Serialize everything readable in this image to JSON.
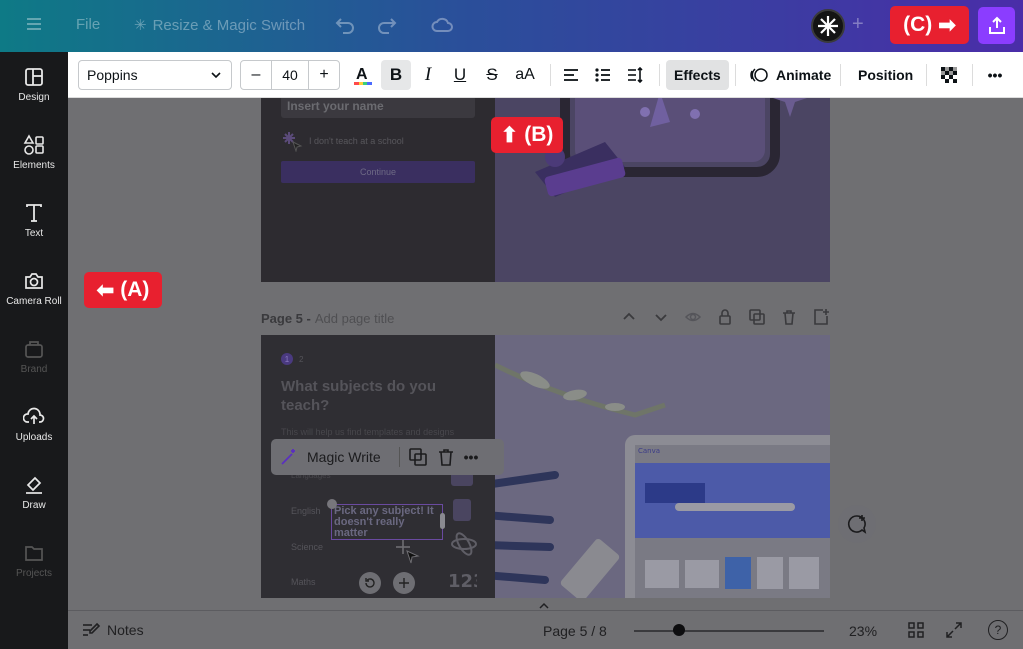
{
  "topbar": {
    "file_label": "File",
    "resize_label": "Resize & Magic Switch",
    "plus_label": "+"
  },
  "sidebar": {
    "items": [
      {
        "label": "Design",
        "icon": "layout-icon",
        "enabled": true
      },
      {
        "label": "Elements",
        "icon": "shapes-icon",
        "enabled": true
      },
      {
        "label": "Text",
        "icon": "text-icon",
        "enabled": true
      },
      {
        "label": "Camera Roll",
        "icon": "camera-icon",
        "enabled": true
      },
      {
        "label": "Brand",
        "icon": "brand-icon",
        "enabled": false
      },
      {
        "label": "Uploads",
        "icon": "upload-cloud-icon",
        "enabled": true
      },
      {
        "label": "Draw",
        "icon": "pen-icon",
        "enabled": true
      },
      {
        "label": "Projects",
        "icon": "folder-icon",
        "enabled": false
      }
    ]
  },
  "text_toolbar": {
    "font": "Poppins",
    "size_minus": "–",
    "font_size": "40",
    "size_plus": "+",
    "bold": "B",
    "italic": "I",
    "underline": "U",
    "strike": "S",
    "case": "aA",
    "effects_label": "Effects",
    "animate_label": "Animate",
    "position_label": "Position",
    "more": "•••"
  },
  "page4": {
    "input_placeholder": "Insert your name",
    "checkbox_label": "I don't teach at a school",
    "continue_label": "Continue"
  },
  "page5": {
    "title": "Page 5 -",
    "title_placeholder": "Add page title",
    "step_1": "1",
    "step_2": "2",
    "heading": "What subjects do you teach?",
    "subtext": "This will help us find templates and designs",
    "option_languages": "Languages",
    "option_english": "English",
    "option_science": "Science",
    "option_maths": "Maths",
    "selected_text": "Pick any subject! It doesn't really matter",
    "laptop_brand": "Canva"
  },
  "magic_bar": {
    "label": "Magic Write",
    "more": "•••"
  },
  "callouts": {
    "a": "(A)",
    "b": "(B)",
    "c": "(C)"
  },
  "bottombar": {
    "notes_label": "Notes",
    "page_indicator": "Page 5 / 8",
    "zoom": "23%",
    "zoom_fraction": 0.06,
    "help": "?"
  },
  "colors": {
    "accent": "#8b3dff",
    "callout": "#e8202f"
  }
}
